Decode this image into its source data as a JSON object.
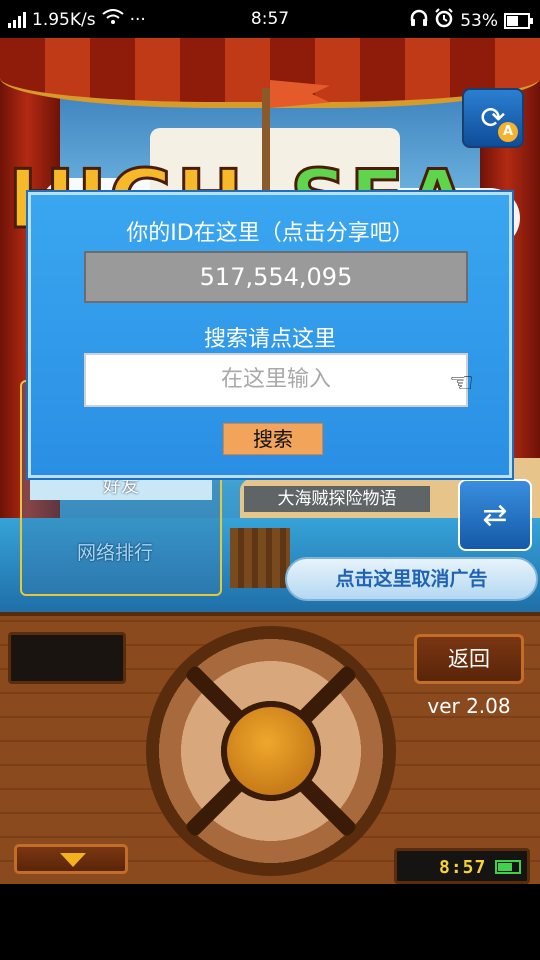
{
  "status_bar": {
    "net_speed": "1.95K/s",
    "more": "···",
    "time": "8:57",
    "battery_percent": "53%",
    "battery_level": 0.53,
    "icons": [
      "signal-icon",
      "wifi-icon",
      "headset-icon",
      "alarm-icon",
      "battery-icon"
    ]
  },
  "game": {
    "logo_left": "HIGH",
    "logo_right": "SEA",
    "friends_tab": "好友",
    "ranking": "网络排行",
    "pirate_story": "大海贼探险物语",
    "cancel_ads": "点击这里取消广告"
  },
  "dialog": {
    "id_title": "你的ID在这里（点击分享吧）",
    "id_value": "517,554,095",
    "search_hint": "搜索请点这里",
    "search_placeholder": "在这里输入",
    "search_button": "搜索"
  },
  "controls": {
    "back": "返回",
    "version": "ver 2.08",
    "game_clock": "8:57"
  },
  "colors": {
    "dialog_bg": "#2a8fe4",
    "id_box": "#9a9a9a",
    "search_button": "#f2a55a",
    "wood": "#8a4a1e"
  }
}
